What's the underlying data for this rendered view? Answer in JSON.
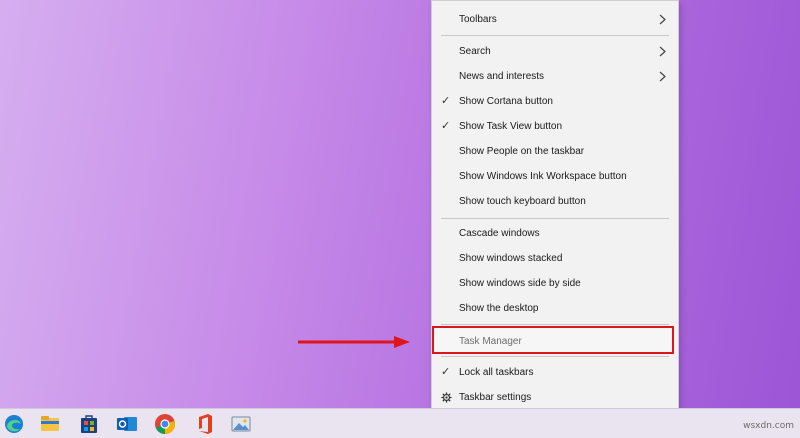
{
  "menu": {
    "items": [
      {
        "label": "Toolbars",
        "submenu": true
      },
      {
        "label": "Search",
        "submenu": true
      },
      {
        "label": "News and interests",
        "submenu": true
      },
      {
        "label": "Show Cortana button",
        "checked": true
      },
      {
        "label": "Show Task View button",
        "checked": true
      },
      {
        "label": "Show People on the taskbar"
      },
      {
        "label": "Show Windows Ink Workspace button"
      },
      {
        "label": "Show touch keyboard button"
      },
      {
        "label": "Cascade windows"
      },
      {
        "label": "Show windows stacked"
      },
      {
        "label": "Show windows side by side"
      },
      {
        "label": "Show the desktop"
      },
      {
        "label": "Task Manager",
        "highlighted": true
      },
      {
        "label": "Lock all taskbars",
        "checked": true
      },
      {
        "label": "Taskbar settings",
        "icon": "gear-icon"
      }
    ],
    "check_glyph": "✓"
  },
  "annotation": {
    "arrow_color": "#e0141b",
    "highlight_color": "#e0141b"
  },
  "taskbar": {
    "icons": [
      "edge-icon",
      "file-explorer-icon",
      "microsoft-store-icon",
      "outlook-icon",
      "chrome-icon",
      "office-icon",
      "photos-icon"
    ]
  },
  "watermark": "wsxdn.com"
}
